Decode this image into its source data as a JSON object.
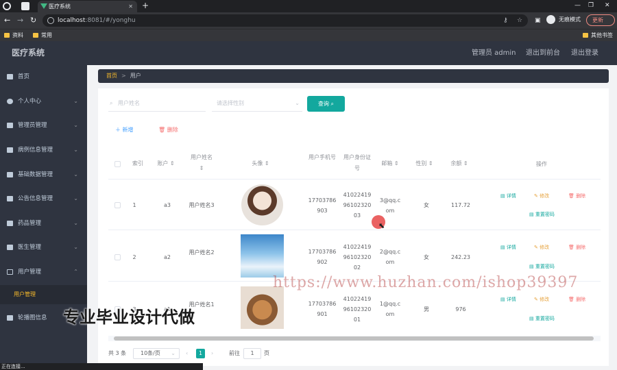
{
  "browser": {
    "tab_title": "医疗系统",
    "url_host": "localhost",
    "url_rest": ":8081/#/yonghu",
    "incognito_label": "无痕模式",
    "update_label": "更新",
    "bookmarks": [
      "资料",
      "常用"
    ],
    "other_bookmarks": "其他书签",
    "status_text": "正在连接..."
  },
  "header": {
    "app_title": "医疗系统",
    "admin_label": "管理员 admin",
    "to_front": "退出到前台",
    "logout": "退出登录"
  },
  "sidebar": {
    "items": [
      {
        "label": "首页",
        "icon": "home-icon"
      },
      {
        "label": "个人中心",
        "icon": "user-icon"
      },
      {
        "label": "管理员管理",
        "icon": "admin-icon"
      },
      {
        "label": "病例信息管理",
        "icon": "list-icon"
      },
      {
        "label": "基础数据管理",
        "icon": "grid-icon"
      },
      {
        "label": "公告信息管理",
        "icon": "grid-icon"
      },
      {
        "label": "药品管理",
        "icon": "pill-icon"
      },
      {
        "label": "医生管理",
        "icon": "send-icon"
      },
      {
        "label": "用户管理",
        "icon": "mail-icon"
      },
      {
        "label": "轮播图信息",
        "icon": "image-icon"
      }
    ],
    "active_sub": "用户管理"
  },
  "breadcrumb": {
    "home": "首页",
    "sep": ">",
    "current": "用户"
  },
  "search": {
    "name_placeholder": "用户姓名",
    "gender_placeholder": "请选择性别",
    "query_label": "查询"
  },
  "actions": {
    "add": "新增",
    "delete": "删除"
  },
  "table": {
    "headers": {
      "index": "索引",
      "account": "账户",
      "name": "用户姓名",
      "avatar": "头像",
      "phone": "用户手机号",
      "idcard": "用户身份证号",
      "email": "邮箱",
      "gender": "性别",
      "balance": "余额",
      "ops": "操作"
    },
    "rows": [
      {
        "index": "1",
        "account": "a3",
        "name": "用户姓名3",
        "phone": "17703786903",
        "idcard": "410224199610232003",
        "email": "3@qq.com",
        "gender": "女",
        "balance": "117.72"
      },
      {
        "index": "2",
        "account": "a2",
        "name": "用户姓名2",
        "phone": "17703786902",
        "idcard": "410224199610232002",
        "email": "2@qq.com",
        "gender": "女",
        "balance": "242.23"
      },
      {
        "index": "3",
        "account": "a1",
        "name": "用户姓名1",
        "phone": "17703786901",
        "idcard": "410224199610232001",
        "email": "1@qq.com",
        "gender": "男",
        "balance": "976"
      }
    ],
    "op_labels": {
      "detail": "详情",
      "modify": "修改",
      "delete": "删除",
      "reset": "重置密码"
    }
  },
  "pagination": {
    "total": "共 3 条",
    "page_size": "10条/页",
    "current": "1",
    "goto_prefix": "前往",
    "goto_value": "1",
    "goto_suffix": "页"
  },
  "watermark": {
    "url": "https://www.huzhan.com/ishop39397",
    "text": "专业毕业设计代做"
  }
}
